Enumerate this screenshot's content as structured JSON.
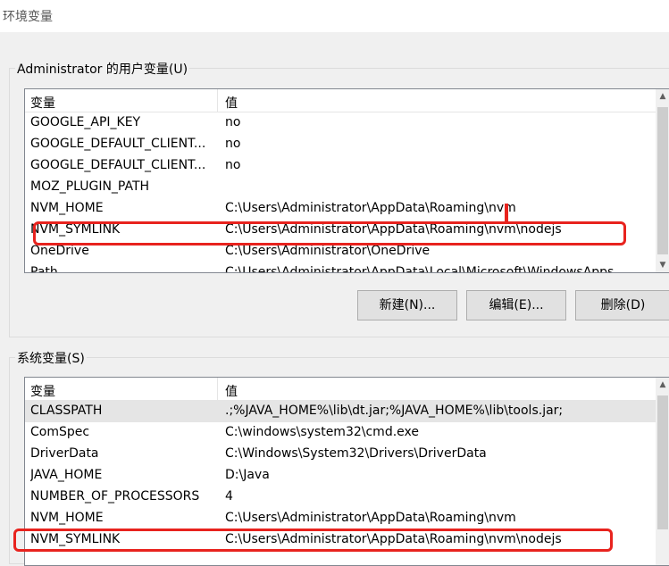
{
  "window": {
    "title": "环境变量"
  },
  "user_vars": {
    "group_label": "Administrator 的用户变量(U)",
    "columns": {
      "name": "变量",
      "value": "值"
    },
    "rows": [
      {
        "name": "GOOGLE_API_KEY",
        "value": "no"
      },
      {
        "name": "GOOGLE_DEFAULT_CLIENT...",
        "value": "no"
      },
      {
        "name": "GOOGLE_DEFAULT_CLIENT...",
        "value": "no"
      },
      {
        "name": "MOZ_PLUGIN_PATH",
        "value": ""
      },
      {
        "name": "NVM_HOME",
        "value": "C:\\Users\\Administrator\\AppData\\Roaming\\nvm"
      },
      {
        "name": "NVM_SYMLINK",
        "value": "C:\\Users\\Administrator\\AppData\\Roaming\\nvm\\nodejs"
      },
      {
        "name": "OneDrive",
        "value": "C:\\Users\\Administrator\\OneDrive"
      },
      {
        "name": "Path",
        "value": "C:\\Users\\Administrator\\AppData\\Local\\Microsoft\\WindowsApps"
      }
    ],
    "buttons": {
      "new": "新建(N)...",
      "edit": "编辑(E)...",
      "delete": "删除(D)"
    }
  },
  "system_vars": {
    "group_label": "系统变量(S)",
    "columns": {
      "name": "变量",
      "value": "值"
    },
    "rows": [
      {
        "name": "CLASSPATH",
        "value": ".;%JAVA_HOME%\\lib\\dt.jar;%JAVA_HOME%\\lib\\tools.jar;"
      },
      {
        "name": "ComSpec",
        "value": "C:\\windows\\system32\\cmd.exe"
      },
      {
        "name": "DriverData",
        "value": "C:\\Windows\\System32\\Drivers\\DriverData"
      },
      {
        "name": "JAVA_HOME",
        "value": "D:\\Java"
      },
      {
        "name": "NUMBER_OF_PROCESSORS",
        "value": "4"
      },
      {
        "name": "NVM_HOME",
        "value": "C:\\Users\\Administrator\\AppData\\Roaming\\nvm"
      },
      {
        "name": "NVM_SYMLINK",
        "value": "C:\\Users\\Administrator\\AppData\\Roaming\\nvm\\nodejs"
      }
    ]
  },
  "colors": {
    "highlight": "#e8231e",
    "selected_row": "#e5e5e5"
  }
}
